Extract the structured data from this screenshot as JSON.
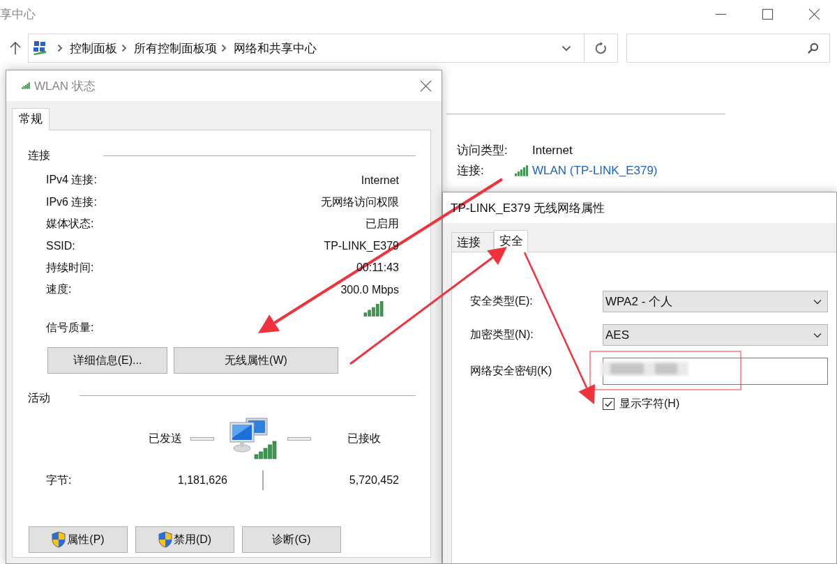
{
  "background_window": {
    "title": "享中心",
    "breadcrumb": [
      "控制面板",
      "所有控制面板项",
      "网络和共享中心"
    ],
    "info": [
      {
        "label": "访问类型:",
        "value": "Internet",
        "kind": "text"
      },
      {
        "label": "连接:",
        "value": "WLAN (TP-LINK_E379)",
        "kind": "link"
      }
    ]
  },
  "status_dialog": {
    "title": "WLAN 状态",
    "tabs": [
      {
        "label": "常规",
        "selected": true
      }
    ],
    "connection_heading": "连接",
    "rows": [
      {
        "label": "IPv4 连接:",
        "value": "Internet"
      },
      {
        "label": "IPv6 连接:",
        "value": "无网络访问权限"
      },
      {
        "label": "媒体状态:",
        "value": "已启用"
      },
      {
        "label": "SSID:",
        "value": "TP-LINK_E379"
      },
      {
        "label": "持续时间:",
        "value": "00:11:43"
      },
      {
        "label": "速度:",
        "value": "300.0 Mbps"
      }
    ],
    "signal_label": "信号质量:",
    "buttons": [
      "详细信息(E)...",
      "无线属性(W)"
    ],
    "activity_heading": "活动",
    "sent_label": "已发送",
    "received_label": "已接收",
    "bytes_label": "字节:",
    "bytes_sent": "1,181,626",
    "bytes_received": "5,720,452",
    "action_buttons": [
      {
        "label": "属性(P)",
        "shield": true
      },
      {
        "label": "禁用(D)",
        "shield": true
      },
      {
        "label": "诊断(G)",
        "shield": false
      }
    ]
  },
  "properties_dialog": {
    "title": "TP-LINK_E379 无线网络属性",
    "tabs": [
      {
        "label": "连接",
        "selected": false
      },
      {
        "label": "安全",
        "selected": true
      }
    ],
    "security_type": {
      "label": "安全类型(E):",
      "value": "WPA2 - 个人"
    },
    "encryption_type": {
      "label": "加密类型(N):",
      "value": "AES"
    },
    "key": {
      "label": "网络安全密钥(K)"
    },
    "show_characters": {
      "label": "显示字符(H)",
      "checked": true
    }
  }
}
